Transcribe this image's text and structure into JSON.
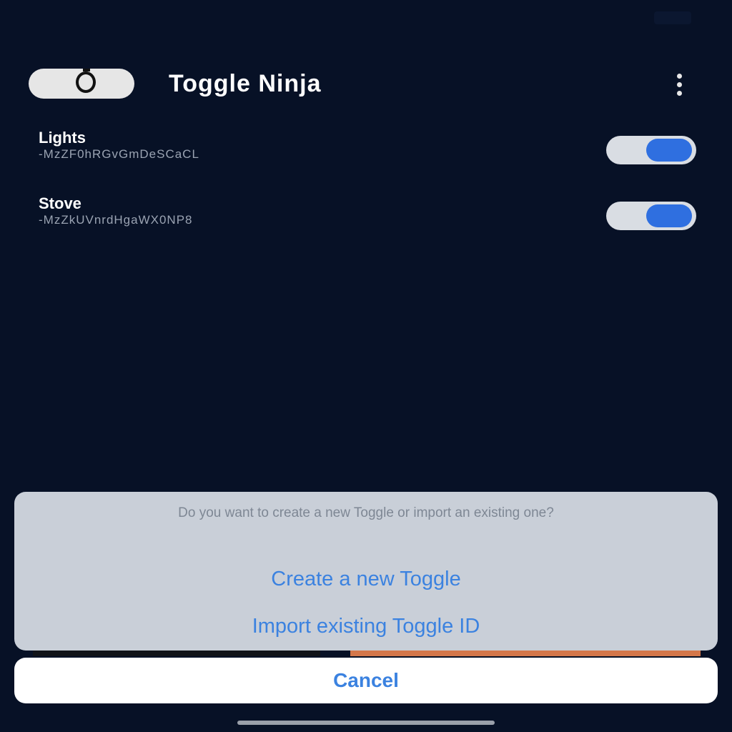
{
  "status_bar": {
    "time": ""
  },
  "header": {
    "title": "Toggle Ninja",
    "logo_icon": "toggle-logo-icon",
    "menu_icon": "more-vertical-icon"
  },
  "toggles": [
    {
      "name": "Lights",
      "id": "-MzZF0hRGvGmDeSCaCL",
      "on": true
    },
    {
      "name": "Stove",
      "id": "-MzZkUVnrdHgaWX0NP8",
      "on": true
    }
  ],
  "action_sheet": {
    "message": "Do you want to create a new Toggle or import an existing one?",
    "actions": [
      "Create a new Toggle",
      "Import existing Toggle ID"
    ],
    "cancel": "Cancel"
  },
  "colors": {
    "background": "#071126",
    "accent": "#3b82e0",
    "switch_knob": "#2f6fe0",
    "sheet": "#c9cfd8"
  }
}
